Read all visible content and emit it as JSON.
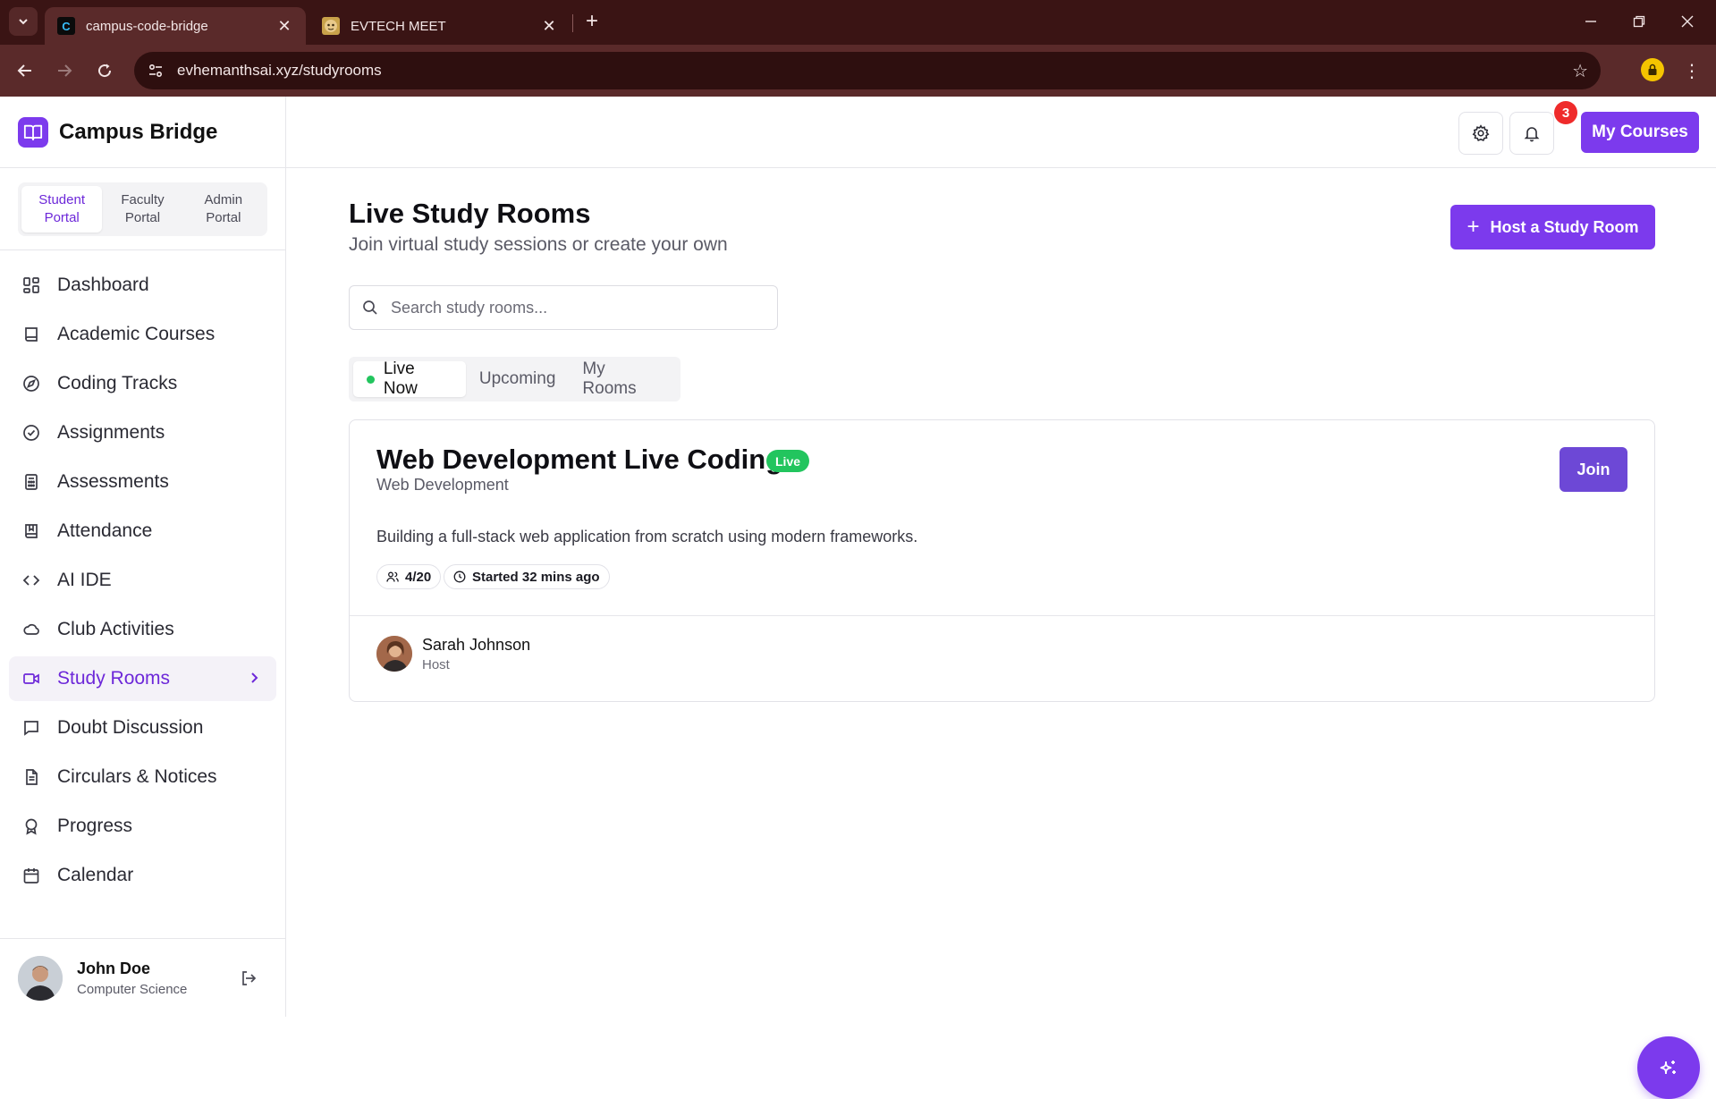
{
  "browser": {
    "tabs": [
      {
        "title": "campus-code-bridge",
        "favicon": "C",
        "active": true
      },
      {
        "title": "EVTECH MEET",
        "favicon": "monkey-icon",
        "active": false
      }
    ],
    "url": "evhemanthsai.xyz/studyrooms"
  },
  "brand": {
    "name": "Campus Bridge",
    "accent": "#7c3aed"
  },
  "portals": [
    {
      "label": "Student\nPortal",
      "active": true
    },
    {
      "label": "Faculty\nPortal",
      "active": false
    },
    {
      "label": "Admin\nPortal",
      "active": false
    }
  ],
  "nav": [
    {
      "label": "Dashboard",
      "icon": "dashboard-icon"
    },
    {
      "label": "Academic Courses",
      "icon": "book-icon"
    },
    {
      "label": "Coding Tracks",
      "icon": "compass-icon"
    },
    {
      "label": "Assignments",
      "icon": "check-circle-icon"
    },
    {
      "label": "Assessments",
      "icon": "calculator-icon"
    },
    {
      "label": "Attendance",
      "icon": "book-bookmark-icon"
    },
    {
      "label": "AI IDE",
      "icon": "code-icon"
    },
    {
      "label": "Club Activities",
      "icon": "tent-icon"
    },
    {
      "label": "Study Rooms",
      "icon": "video-icon",
      "active": true
    },
    {
      "label": "Doubt Discussion",
      "icon": "message-square-icon"
    },
    {
      "label": "Circulars & Notices",
      "icon": "file-text-icon"
    },
    {
      "label": "Progress",
      "icon": "award-icon"
    },
    {
      "label": "Calendar",
      "icon": "calendar-icon"
    }
  ],
  "user": {
    "name": "John Doe",
    "dept": "Computer Science"
  },
  "topbar": {
    "notifications": "3",
    "my_courses": "My Courses"
  },
  "page": {
    "title": "Live Study Rooms",
    "subtitle": "Join virtual study sessions or create your own",
    "host_button": "Host a Study Room",
    "search_placeholder": "Search study rooms...",
    "tabs": [
      {
        "label": "Live Now",
        "active": true
      },
      {
        "label": "Upcoming",
        "active": false
      },
      {
        "label": "My Rooms",
        "active": false
      }
    ]
  },
  "room": {
    "title": "Web Development Live Coding",
    "status": "Live",
    "category": "Web Development",
    "join": "Join",
    "description": "Building a full-stack web application from scratch using modern frameworks.",
    "participants": "4/20",
    "started": "Started 32 mins ago",
    "host_name": "Sarah Johnson",
    "host_role": "Host"
  }
}
